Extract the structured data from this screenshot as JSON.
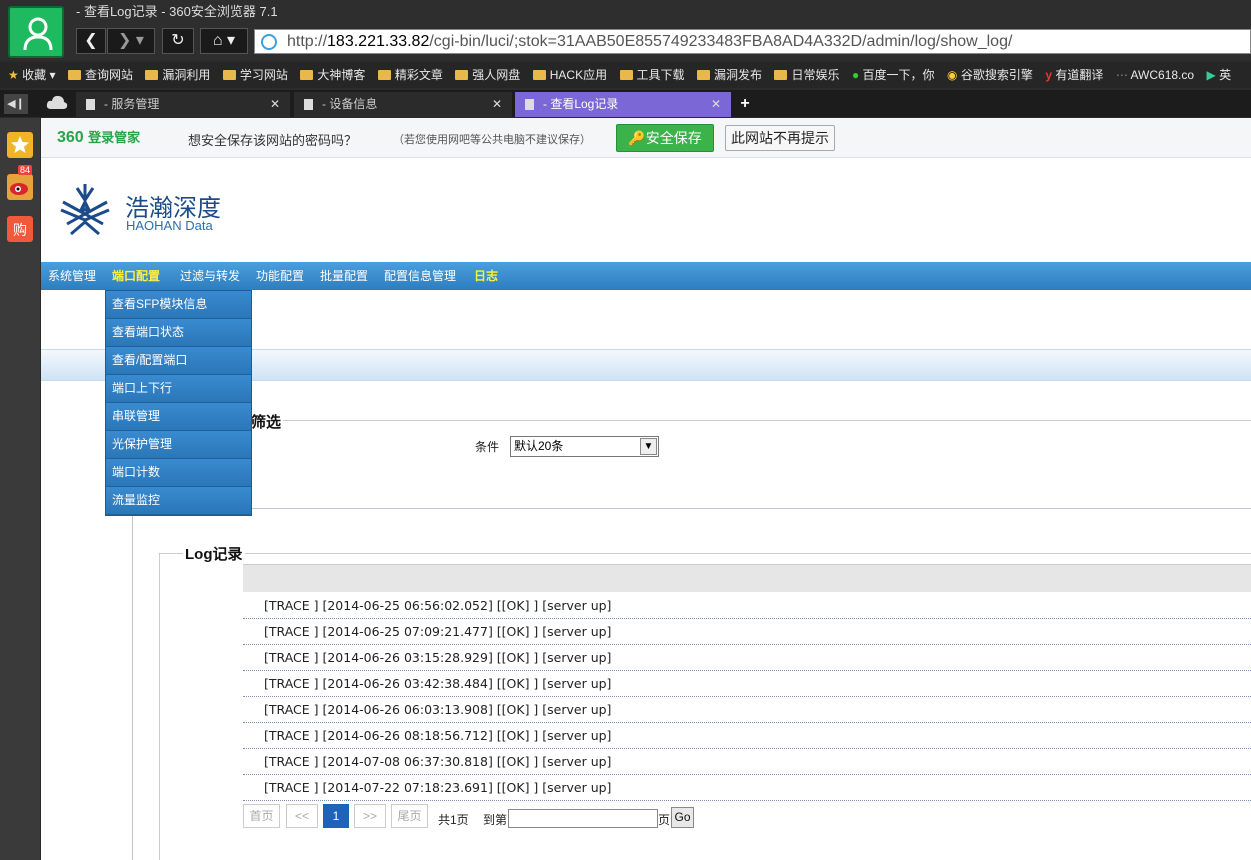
{
  "browser": {
    "window_title": "- 查看Log记录 - 360安全浏览器 7.1",
    "url_prefix": "http://",
    "url_host": "183.221.33.82",
    "url_path": "/cgi-bin/luci/;stok=31AAB50E855749233483FBA8AD4A332D/admin/log/show_log/",
    "bookmarks": [
      "收藏",
      "查询网站",
      "漏洞利用",
      "学习网站",
      "大神博客",
      "精彩文章",
      "强人网盘",
      "HACK应用",
      "工具下载",
      "漏洞发布",
      "日常娱乐",
      "百度一下，你",
      "谷歌搜索引擎",
      "有道翻译",
      "AWC618.co",
      "英"
    ],
    "tabs": [
      {
        "label": "- 服务管理"
      },
      {
        "label": "- 设备信息"
      },
      {
        "label": "- 查看Log记录"
      }
    ],
    "weibo_badge": "84",
    "cart_glyph": "购"
  },
  "password_bar": {
    "brand": "360",
    "brand_sub": "登录管家",
    "question": "想安全保存该网站的密码吗？",
    "note": "（若您使用网吧等公共电脑不建议保存）",
    "save_label": "安全保存",
    "never_label": "此网站不再提示"
  },
  "site": {
    "logo_cn": "浩瀚深度",
    "logo_en": "HAOHAN Data",
    "menu": [
      "系统管理",
      "端口配置",
      "过滤与转发",
      "功能配置",
      "批量配置",
      "配置信息管理",
      "日志"
    ],
    "dropdown": [
      "查看SFP模块信息",
      "查看端口状态",
      "查看/配置端口",
      "端口上下行",
      "串联管理",
      "光保护管理",
      "端口计数",
      "流量监控"
    ]
  },
  "filter": {
    "legend": "筛选",
    "condition_label": "条件",
    "condition_value": "默认20条"
  },
  "log": {
    "legend": "Log记录",
    "rows": [
      "[TRACE ] [2014-06-25 06:56:02.052] [[OK] ] [server up]",
      "[TRACE ] [2014-06-25 07:09:21.477] [[OK] ] [server up]",
      "[TRACE ] [2014-06-26 03:15:28.929] [[OK] ] [server up]",
      "[TRACE ] [2014-06-26 03:42:38.484] [[OK] ] [server up]",
      "[TRACE ] [2014-06-26 06:03:13.908] [[OK] ] [server up]",
      "[TRACE ] [2014-06-26 08:18:56.712] [[OK] ] [server up]",
      "[TRACE ] [2014-07-08 06:37:30.818] [[OK] ] [server up]",
      "[TRACE ] [2014-07-22 07:18:23.691] [[OK] ] [server up]"
    ]
  },
  "pagination": {
    "first": "首页",
    "prev": "<<",
    "current": "1",
    "next": ">>",
    "last": "尾页",
    "total": "共1页",
    "goto_label": "到第",
    "goto_unit": "页",
    "go": "Go"
  }
}
